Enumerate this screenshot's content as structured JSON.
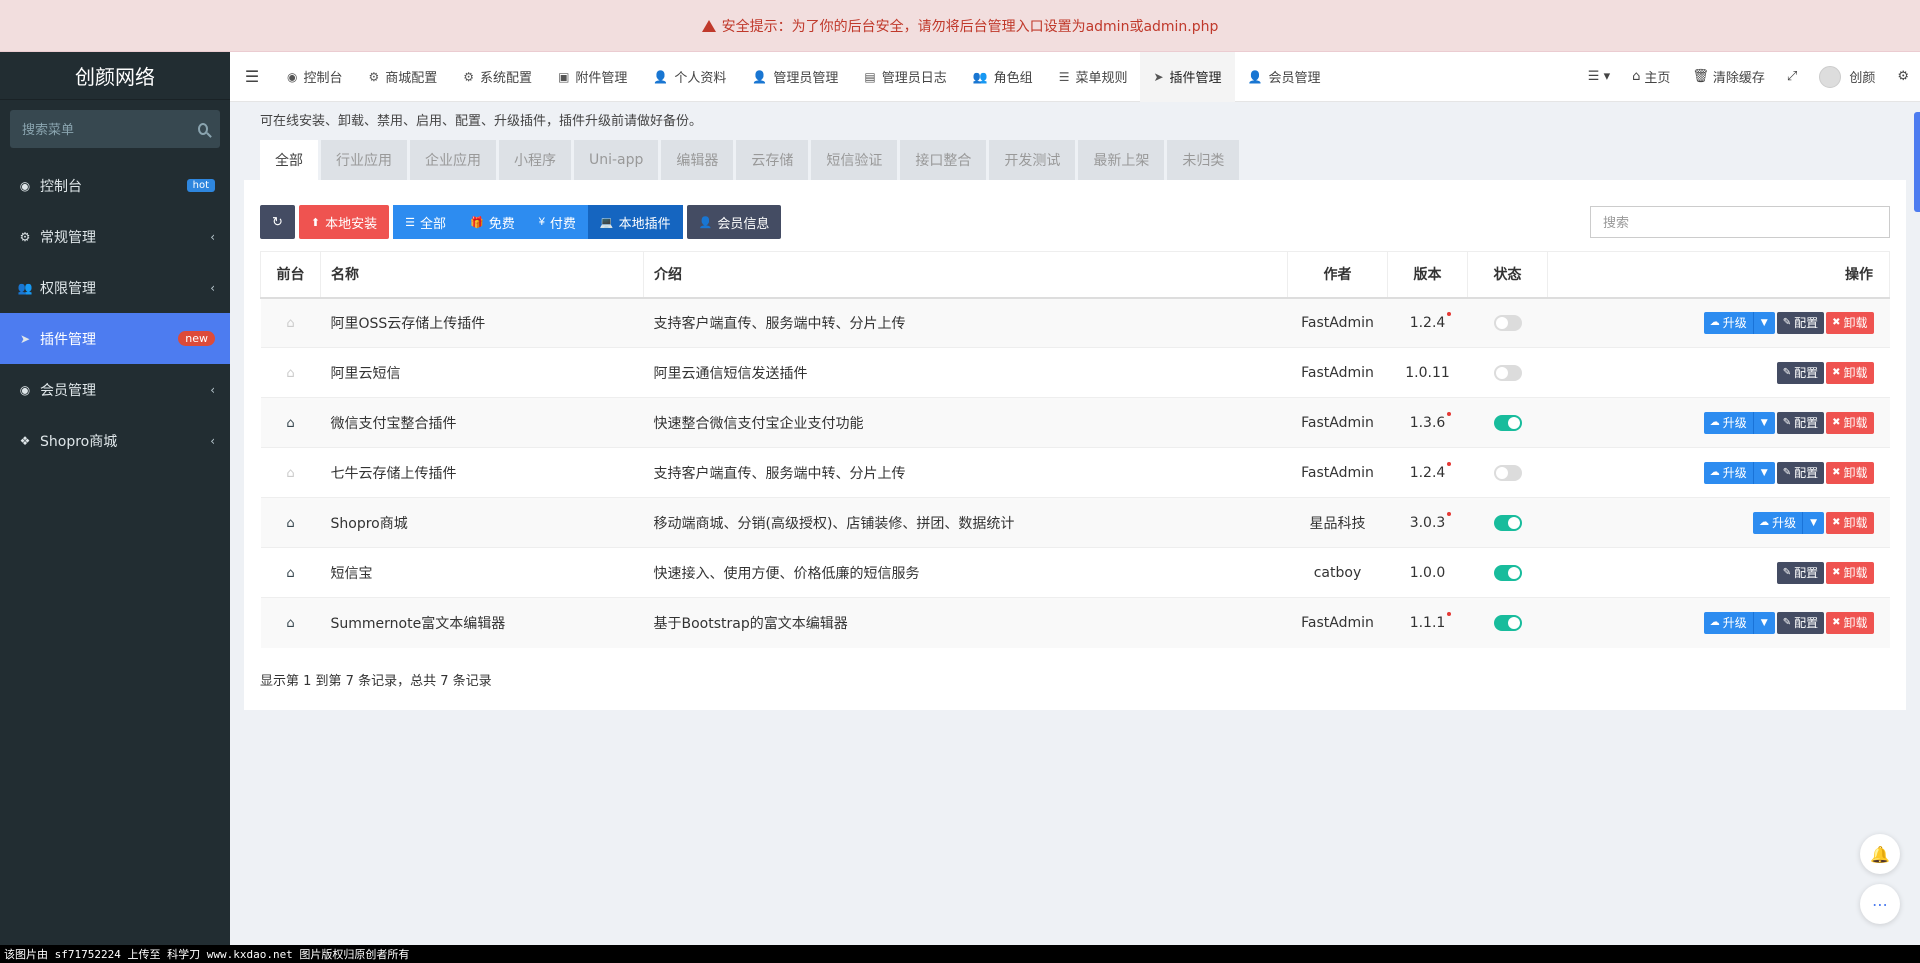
{
  "alert": {
    "text": "安全提示：为了你的后台安全，请勿将后台管理入口设置为admin或admin.php"
  },
  "sidebar": {
    "logo": "创颜网络",
    "search_placeholder": "搜索菜单",
    "items": [
      {
        "label": "控制台",
        "badge": "hot",
        "icon": "dashboard-icon"
      },
      {
        "label": "常规管理",
        "icon": "cogs-icon"
      },
      {
        "label": "权限管理",
        "icon": "group-icon"
      },
      {
        "label": "插件管理",
        "badge": "new",
        "icon": "rocket-icon",
        "active": true
      },
      {
        "label": "会员管理",
        "icon": "user-circle-icon"
      },
      {
        "label": "Shopro商城",
        "icon": "dropbox-icon"
      }
    ]
  },
  "navbar": {
    "tabs": [
      {
        "label": "控制台",
        "icon": "dashboard-icon"
      },
      {
        "label": "商城配置",
        "icon": "cogs-icon"
      },
      {
        "label": "系统配置",
        "icon": "cog-icon"
      },
      {
        "label": "附件管理",
        "icon": "image-icon"
      },
      {
        "label": "个人资料",
        "icon": "user-icon"
      },
      {
        "label": "管理员管理",
        "icon": "user-icon"
      },
      {
        "label": "管理员日志",
        "icon": "list-alt-icon"
      },
      {
        "label": "角色组",
        "icon": "group-icon"
      },
      {
        "label": "菜单规则",
        "icon": "bars-icon"
      },
      {
        "label": "插件管理",
        "icon": "rocket-icon",
        "active": true
      },
      {
        "label": "会员管理",
        "icon": "user-icon"
      }
    ],
    "right": {
      "home": "主页",
      "clear_cache": "清除缓存",
      "username": "创颜"
    }
  },
  "page": {
    "description": "可在线安装、卸载、禁用、启用、配置、升级插件，插件升级前请做好备份。",
    "categories": [
      "全部",
      "行业应用",
      "企业应用",
      "小程序",
      "Uni-app",
      "编辑器",
      "云存储",
      "短信验证",
      "接口整合",
      "开发测试",
      "最新上架",
      "未归类"
    ],
    "toolbar": {
      "local_install": "本地安装",
      "filter_all": "全部",
      "filter_free": "免费",
      "filter_paid": "付费",
      "filter_local": "本地插件",
      "member_info": "会员信息",
      "search_placeholder": "搜索"
    },
    "table": {
      "headers": {
        "frontend": "前台",
        "name": "名称",
        "intro": "介绍",
        "author": "作者",
        "version": "版本",
        "status": "状态",
        "actions": "操作"
      },
      "action_labels": {
        "upgrade": "升级",
        "config": "配置",
        "uninstall": "卸载"
      },
      "rows": [
        {
          "name": "阿里OSS云存储上传插件",
          "intro": "支持客户端直传、服务端中转、分片上传",
          "author": "FastAdmin",
          "version": "1.2.4",
          "update": true,
          "enabled": false,
          "frontend": false,
          "upgrade": true,
          "config": true
        },
        {
          "name": "阿里云短信",
          "intro": "阿里云通信短信发送插件",
          "author": "FastAdmin",
          "version": "1.0.11",
          "update": false,
          "enabled": false,
          "frontend": false,
          "upgrade": false,
          "config": true
        },
        {
          "name": "微信支付宝整合插件",
          "intro": "快速整合微信支付宝企业支付功能",
          "author": "FastAdmin",
          "version": "1.3.6",
          "update": true,
          "enabled": true,
          "frontend": true,
          "upgrade": true,
          "config": true
        },
        {
          "name": "七牛云存储上传插件",
          "intro": "支持客户端直传、服务端中转、分片上传",
          "author": "FastAdmin",
          "version": "1.2.4",
          "update": true,
          "enabled": false,
          "frontend": false,
          "upgrade": true,
          "config": true
        },
        {
          "name": "Shopro商城",
          "intro": "移动端商城、分销(高级授权)、店铺装修、拼团、数据统计",
          "author": "星品科技",
          "version": "3.0.3",
          "update": true,
          "enabled": true,
          "frontend": true,
          "upgrade": true,
          "config": false
        },
        {
          "name": "短信宝",
          "intro": "快速接入、使用方便、价格低廉的短信服务",
          "author": "catboy",
          "version": "1.0.0",
          "update": false,
          "enabled": true,
          "frontend": true,
          "upgrade": false,
          "config": true
        },
        {
          "name": "Summernote富文本编辑器",
          "intro": "基于Bootstrap的富文本编辑器",
          "author": "FastAdmin",
          "version": "1.1.1",
          "update": true,
          "enabled": true,
          "frontend": true,
          "upgrade": true,
          "config": true
        }
      ]
    },
    "pagination": "显示第 1 到第 7 条记录，总共 7 条记录"
  },
  "watermark": "该图片由 sf71752224 上传至 科学刀 www.kxdao.net 图片版权归原创者所有",
  "colors": {
    "sidebar_bg": "#222d32",
    "active_blue": "#4d7cf0",
    "danger": "#ef5350",
    "primary": "#2d8cf0",
    "dark_btn": "#444c63",
    "toggle_on": "#18bc9c"
  }
}
